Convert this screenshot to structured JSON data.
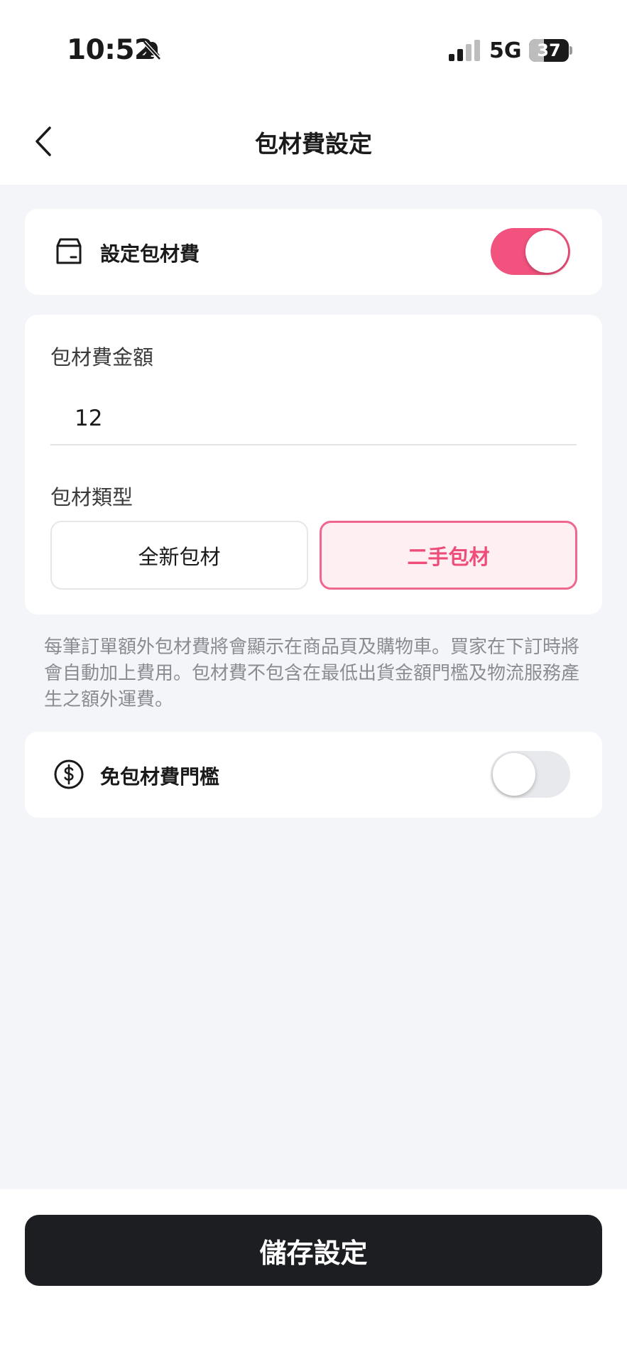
{
  "status_bar": {
    "time": "10:52",
    "network": "5G",
    "battery": "37",
    "battery_level": 0.37,
    "icons": [
      "bell-slash-icon",
      "signal-icon"
    ]
  },
  "nav": {
    "title": "包材費設定",
    "back_icon": "chevron-left-icon"
  },
  "packaging_fee": {
    "icon": "box-icon",
    "label": "設定包材費",
    "enabled": true
  },
  "fee_form": {
    "amount_label": "包材費金額",
    "amount_value": "12",
    "type_label": "包材類型",
    "types": [
      {
        "label": "全新包材",
        "selected": false
      },
      {
        "label": "二手包材",
        "selected": true
      }
    ]
  },
  "note": "每筆訂單額外包材費將會顯示在商品頁及購物車。買家在下訂時將會自動加上費用。包材費不包含在最低出貨金額門檻及物流服務產生之額外運費。",
  "free_threshold": {
    "icon": "dollar-circle-icon",
    "label": "免包材費門檻",
    "enabled": false
  },
  "save_button": "儲存設定",
  "colors": {
    "accent": "#f2527e",
    "accent_bg": "#fdeff2",
    "button_dark": "#1c1e22",
    "page_bg": "#f4f5f8"
  }
}
